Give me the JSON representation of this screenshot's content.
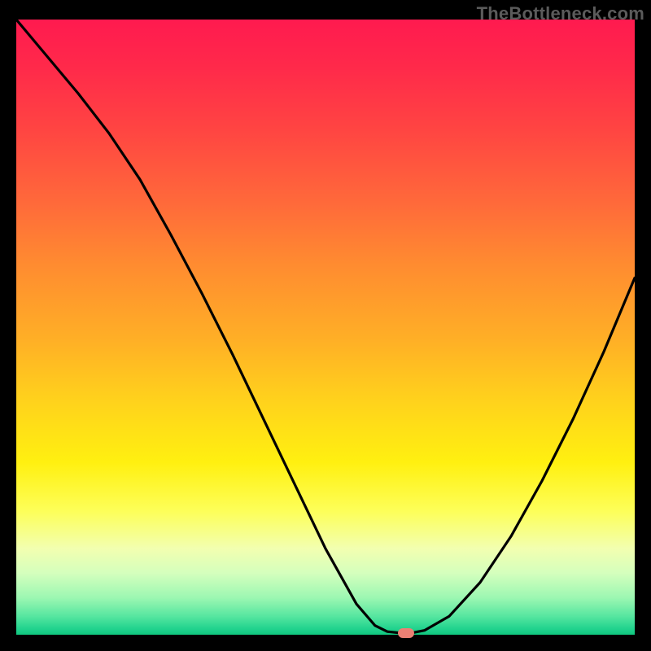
{
  "watermark": "TheBottleneck.com",
  "chart_data": {
    "type": "line",
    "title": "",
    "xlabel": "",
    "ylabel": "",
    "xlim": [
      0,
      100
    ],
    "ylim": [
      0,
      100
    ],
    "grid": false,
    "series": [
      {
        "name": "curve",
        "color": "#000000",
        "x": [
          0.0,
          5,
          10,
          15,
          20,
          25,
          30,
          35,
          40,
          45,
          50,
          55,
          58,
          60,
          62,
          64,
          66,
          70,
          75,
          80,
          85,
          90,
          95,
          100
        ],
        "y": [
          100,
          94,
          88,
          81.5,
          74,
          65,
          55.5,
          45.5,
          35,
          24.5,
          14,
          5,
          1.5,
          0.5,
          0.3,
          0.3,
          0.7,
          3,
          8.5,
          16,
          25,
          35,
          46,
          58
        ]
      }
    ],
    "marker": {
      "x": 63,
      "y": 0.3,
      "color": "#ec8074"
    },
    "background_gradient": {
      "stops": [
        {
          "pos": 0.0,
          "color": "#ff1a4f"
        },
        {
          "pos": 0.4,
          "color": "#ff8c30"
        },
        {
          "pos": 0.72,
          "color": "#fff010"
        },
        {
          "pos": 0.9,
          "color": "#d4ffbd"
        },
        {
          "pos": 1.0,
          "color": "#0fc77f"
        }
      ]
    }
  }
}
